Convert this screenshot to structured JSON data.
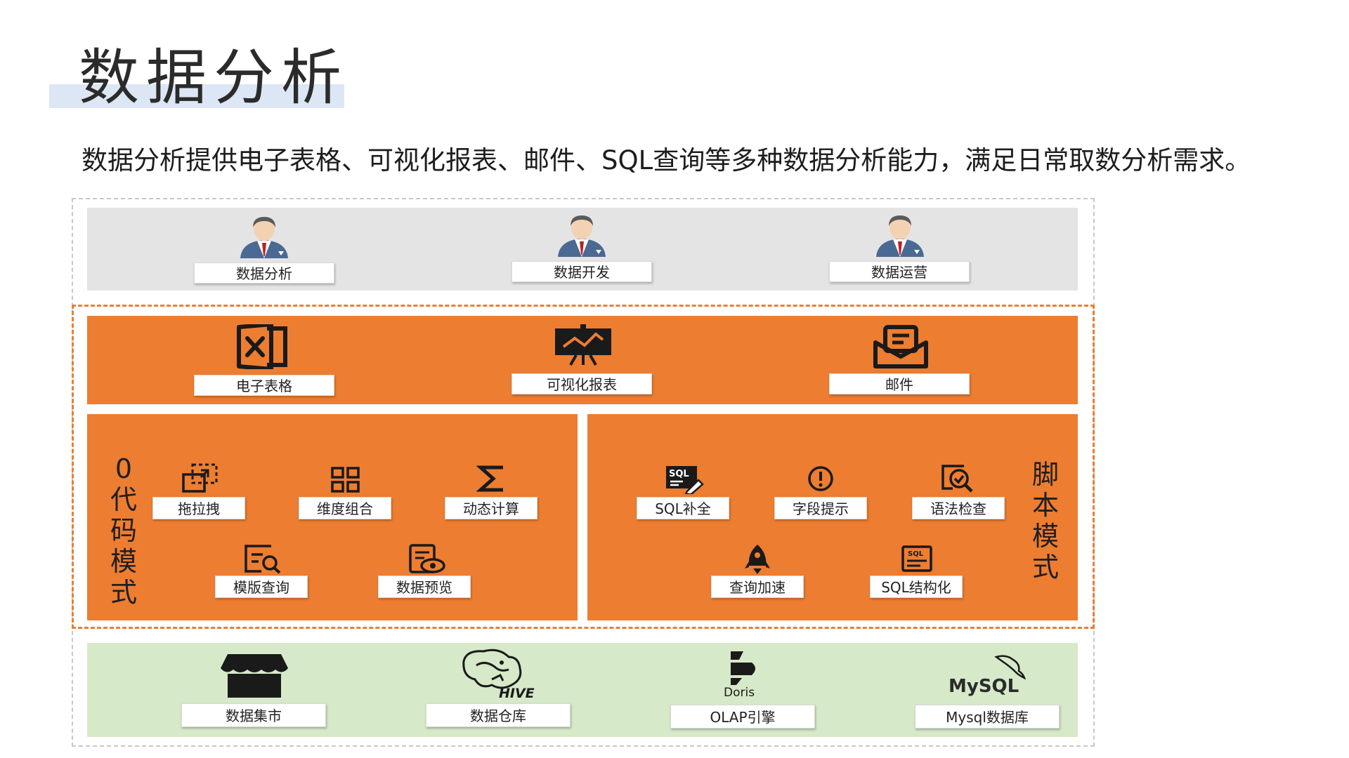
{
  "header": {
    "title": "数据分析",
    "subtitle": "数据分析提供电子表格、可视化报表、邮件、SQL查询等多种数据分析能力，满足日常取数分析需求。"
  },
  "colors": {
    "accent": "#ed7d31",
    "users_band": "#e4e4e4",
    "data_band": "#d6e9c8",
    "title_bar": "#dce6f4"
  },
  "roles": [
    {
      "label": "数据分析",
      "icon": "user-icon"
    },
    {
      "label": "数据开发",
      "icon": "user-icon"
    },
    {
      "label": "数据运营",
      "icon": "user-icon"
    }
  ],
  "apps": [
    {
      "label": "电子表格",
      "icon": "spreadsheet-icon"
    },
    {
      "label": "可视化报表",
      "icon": "presentation-chart-icon"
    },
    {
      "label": "邮件",
      "icon": "mail-icon"
    }
  ],
  "no_code": {
    "title": [
      "0",
      "代",
      "码",
      "模",
      "式"
    ],
    "items": [
      {
        "label": "拖拉拽",
        "icon": "drag-drop-icon"
      },
      {
        "label": "维度组合",
        "icon": "grid-icon"
      },
      {
        "label": "动态计算",
        "icon": "sigma-icon"
      },
      {
        "label": "模版查询",
        "icon": "template-search-icon"
      },
      {
        "label": "数据预览",
        "icon": "preview-icon"
      }
    ]
  },
  "script_mode": {
    "title": [
      "脚",
      "本",
      "模",
      "式"
    ],
    "items": [
      {
        "label": "SQL补全",
        "icon": "sql-edit-icon",
        "icon_text": "SQL"
      },
      {
        "label": "字段提示",
        "icon": "alert-icon"
      },
      {
        "label": "语法检查",
        "icon": "check-search-icon"
      },
      {
        "label": "查询加速",
        "icon": "rocket-icon"
      },
      {
        "label": "SQL结构化",
        "icon": "sql-structure-icon",
        "icon_text": "SQL"
      }
    ]
  },
  "data_sources": [
    {
      "label": "数据集市",
      "icon": "store-icon"
    },
    {
      "label": "数据仓库",
      "icon": "hive-logo",
      "logo_text": "HIVE"
    },
    {
      "label": "OLAP引擎",
      "icon": "doris-logo",
      "logo_text": "Doris"
    },
    {
      "label": "Mysql数据库",
      "icon": "mysql-logo",
      "logo_text": "MySQL"
    }
  ]
}
